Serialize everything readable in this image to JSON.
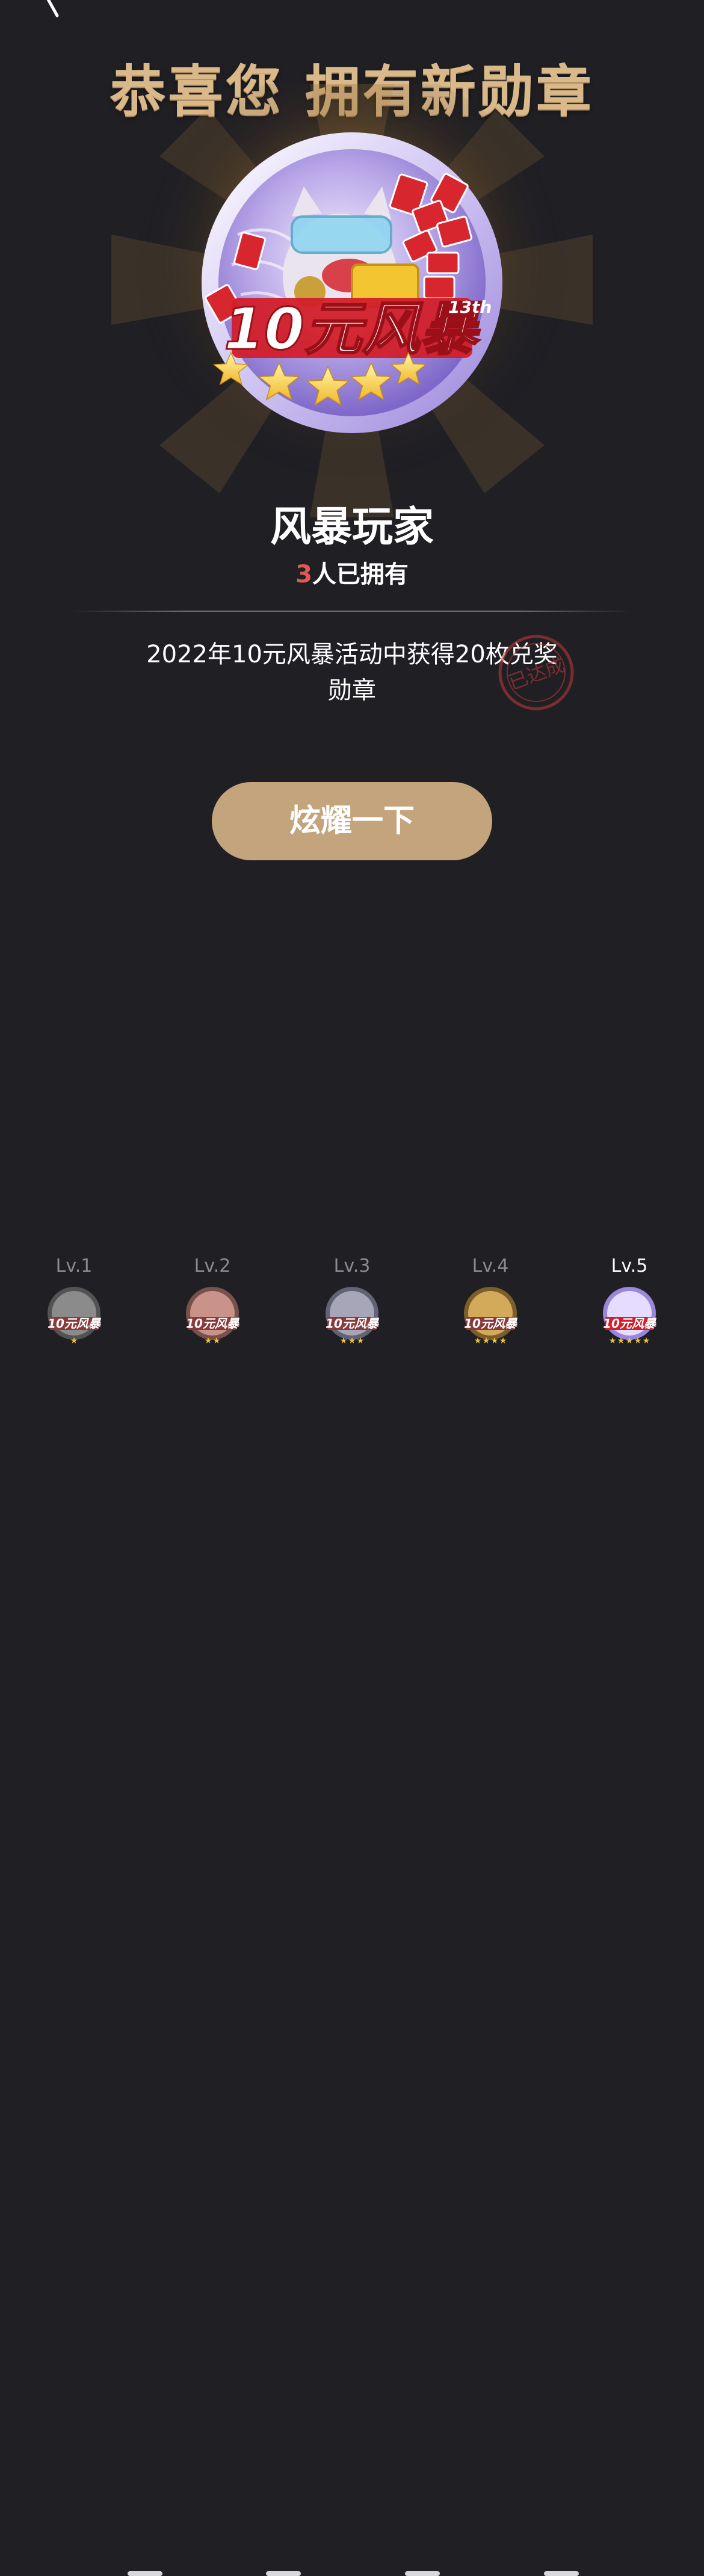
{
  "header": {
    "title": "恭喜您 拥有新勋章"
  },
  "medal": {
    "art_text": "10元风暴",
    "edition": "13th",
    "tag_text": "10",
    "stars": 5
  },
  "badge": {
    "name": "风暴玩家",
    "owners_count": "3",
    "owners_suffix": "人已拥有",
    "description": "2022年10元风暴活动中获得20枚兑奖勋章",
    "stamp_text": "已达成"
  },
  "actions": {
    "show_off_label": "炫耀一下"
  },
  "levels": [
    {
      "label": "Lv.1",
      "stars": 1,
      "active": false
    },
    {
      "label": "Lv.2",
      "stars": 2,
      "active": false
    },
    {
      "label": "Lv.3",
      "stars": 3,
      "active": false
    },
    {
      "label": "Lv.4",
      "stars": 4,
      "active": false
    },
    {
      "label": "Lv.5",
      "stars": 5,
      "active": true
    }
  ],
  "colors": {
    "background": "#1f1f24",
    "title_gold": "#d9b88a",
    "button": "#c4a47c",
    "count_red": "#e05a54"
  }
}
